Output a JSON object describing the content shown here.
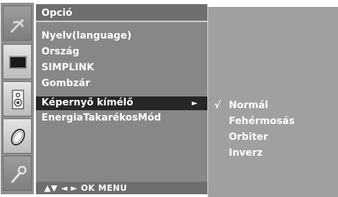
{
  "sidebar": {
    "icons": [
      {
        "name": "satellite-icon"
      },
      {
        "name": "picture-icon"
      },
      {
        "name": "speaker-icon"
      },
      {
        "name": "clock-icon"
      },
      {
        "name": "option-icon"
      }
    ]
  },
  "menu": {
    "title": "Opció",
    "items": [
      {
        "label": "Nyelv(language)"
      },
      {
        "label": "Ország"
      },
      {
        "label": "SIMPLINK"
      },
      {
        "label": "Gombzár"
      },
      {
        "label": "Képernyő kímélő",
        "selected": true,
        "arrow": "►"
      },
      {
        "label": "EnergiaTakarékosMód"
      }
    ],
    "footer": "▲▼  ◄ ►  OK  MENU"
  },
  "submenu": {
    "check_mark": "√",
    "items": [
      {
        "label": "Normál",
        "checked": true
      },
      {
        "label": "Fehérmosás"
      },
      {
        "label": "Orbiter"
      },
      {
        "label": "Inverz"
      }
    ]
  },
  "colors": {
    "menu_bg": "#878787",
    "title_bg": "#6e6e6e",
    "selected_bg": "#262626",
    "submenu_bg": "#a0a0a0",
    "text": "#ffffff"
  }
}
